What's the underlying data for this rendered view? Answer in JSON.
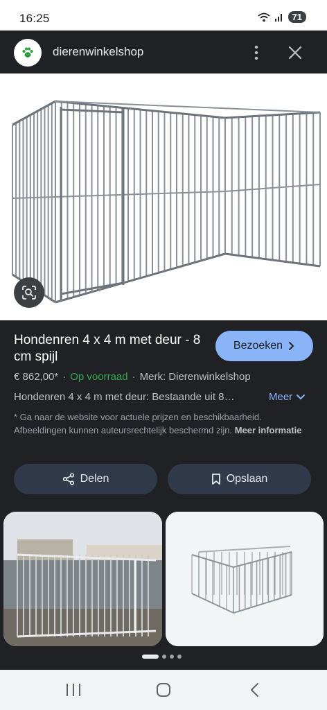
{
  "status_bar": {
    "time": "16:25",
    "battery": "71"
  },
  "header": {
    "site_name": "dierenwinkelshop",
    "logo_icon": "paw-icon"
  },
  "product": {
    "title": "Hondenren 4 x 4 m met deur - 8 cm spijl",
    "price": "€ 862,00*",
    "stock": "Op voorraad",
    "brand": "Merk: Dierenwinkelshop",
    "description": "Hondenren 4 x 4 m met deur: Bestaande uit 8…",
    "more_label": "Meer",
    "disclaimer": "* Ga naar de website voor actuele prijzen en beschikbaarheid. Afbeeldingen kunnen auteursrechtelijk beschermd zijn.",
    "more_info_label": "Meer informatie"
  },
  "actions": {
    "visit_label": "Bezoeken",
    "share_label": "Delen",
    "save_label": "Opslaan"
  },
  "colors": {
    "accent": "#8ab4f8",
    "stock_green": "#34a853",
    "background": "#202124",
    "pill": "#303a4a"
  },
  "carousel": {
    "active_index": 0,
    "count": 4
  }
}
